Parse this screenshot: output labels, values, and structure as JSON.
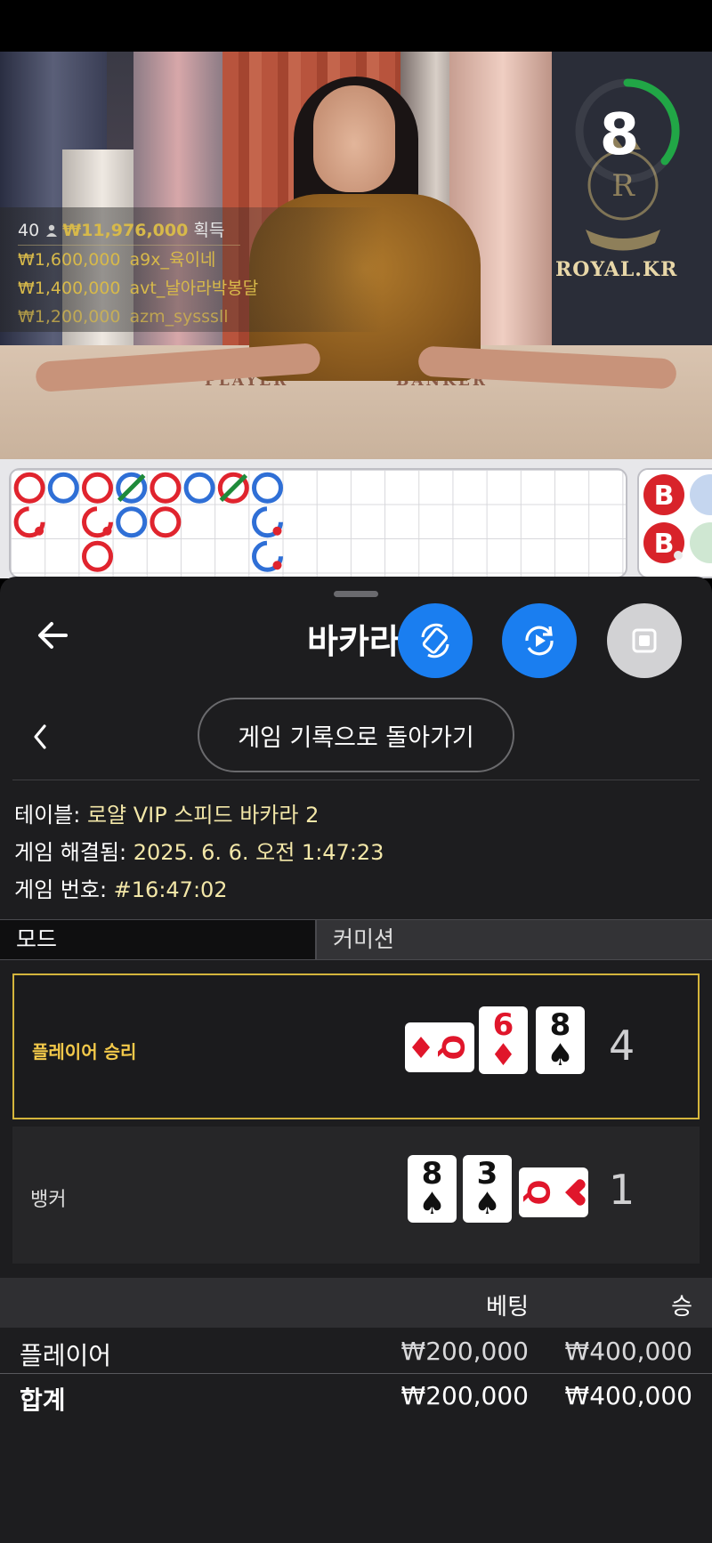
{
  "video": {
    "timer": "8",
    "logo_text": "ROYAL.KR",
    "felt_player": "PLAYER",
    "felt_banker": "BANKER",
    "winners_header": {
      "count": "40",
      "amount": "₩11,976,000",
      "suffix": "획득"
    },
    "winners": [
      {
        "amount": "₩1,600,000",
        "name": "a9x_육이네"
      },
      {
        "amount": "₩1,400,000",
        "name": "avt_날아라박봉달"
      },
      {
        "amount": "₩1,200,000",
        "name": "azm_sysssll"
      }
    ]
  },
  "road": {
    "big_road_markers": [
      {
        "col": 0,
        "row": 0,
        "color": "red"
      },
      {
        "col": 0,
        "row": 1,
        "color": "red",
        "partial": true
      },
      {
        "col": 1,
        "row": 0,
        "color": "blue"
      },
      {
        "col": 2,
        "row": 0,
        "color": "red"
      },
      {
        "col": 2,
        "row": 1,
        "color": "red",
        "partial": true
      },
      {
        "col": 2,
        "row": 2,
        "color": "red"
      },
      {
        "col": 3,
        "row": 0,
        "color": "blue",
        "tie": true
      },
      {
        "col": 3,
        "row": 1,
        "color": "blue"
      },
      {
        "col": 4,
        "row": 0,
        "color": "red"
      },
      {
        "col": 4,
        "row": 1,
        "color": "red"
      },
      {
        "col": 5,
        "row": 0,
        "color": "blue"
      },
      {
        "col": 6,
        "row": 0,
        "color": "red",
        "tie": true
      },
      {
        "col": 7,
        "row": 0,
        "color": "blue"
      },
      {
        "col": 7,
        "row": 1,
        "color": "blue",
        "partial": true
      },
      {
        "col": 7,
        "row": 2,
        "color": "blue",
        "partial": true
      }
    ],
    "bead_labels": [
      "B",
      "B"
    ]
  },
  "sheet": {
    "title": "바카라",
    "back_to_history": "게임 기록으로 돌아가기",
    "table_label": "테이블: ",
    "table_value": "로얄 VIP 스피드 바카라 2",
    "resolved_label": "게임 해결됨: ",
    "resolved_value": "2025. 6. 6. 오전 1:47:23",
    "game_no_label": "게임 번호: ",
    "game_no_value": "#16:47:02",
    "mode_label": "모드",
    "commission_label": "커미션",
    "player_result_label": "플레이어 승리",
    "player_score": "4",
    "player_cards": [
      {
        "rank": "Q",
        "suit": "♦",
        "color": "red",
        "rotated": true
      },
      {
        "rank": "6",
        "suit": "♦",
        "color": "red"
      },
      {
        "rank": "8",
        "suit": "♠",
        "color": "black"
      }
    ],
    "banker_label": "뱅커",
    "banker_score": "1",
    "banker_cards": [
      {
        "rank": "8",
        "suit": "♠",
        "color": "black"
      },
      {
        "rank": "3",
        "suit": "♠",
        "color": "black"
      },
      {
        "rank": "Q",
        "suit": "♥",
        "color": "red",
        "rotated": true
      }
    ],
    "bets_header": {
      "bet": "베팅",
      "win": "승"
    },
    "bet_rows": [
      {
        "name": "플레이어",
        "bet": "₩200,000",
        "win": "₩400,000"
      }
    ],
    "total": {
      "name": "합계",
      "bet": "₩200,000",
      "win": "₩400,000"
    }
  },
  "colors": {
    "accent_blue": "#1a7ef0",
    "gold": "#d4b53c",
    "road_red": "#e0242e",
    "road_blue": "#2f6fd6",
    "timer_green": "#21a646"
  }
}
